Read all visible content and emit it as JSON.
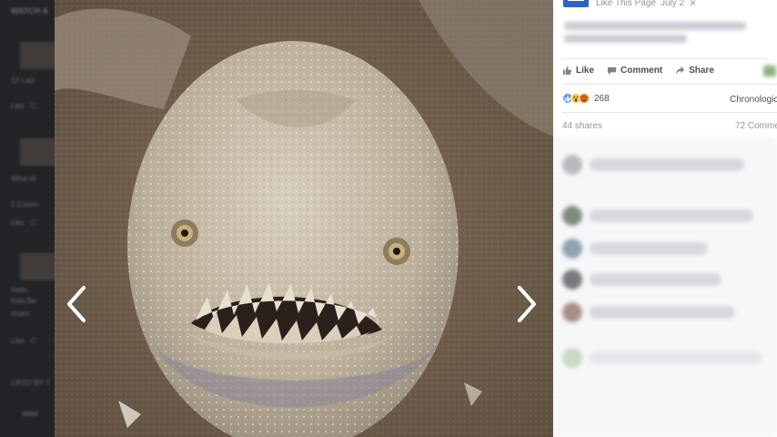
{
  "background_feed": {
    "header": "WATCH A",
    "labels": [
      "12 Last",
      "Like · C",
      "What di",
      "2 Comm",
      "Like · C",
      "Hello",
      "Kids Ba",
      "share",
      "Like · C",
      "LIKED BY T"
    ]
  },
  "viewer": {
    "prev_label": "Previous photo",
    "next_label": "Next photo"
  },
  "post": {
    "like_page": "Like This Page",
    "date": "July 2",
    "close_glyph": "×"
  },
  "actions": {
    "like": "Like",
    "comment": "Comment",
    "share": "Share"
  },
  "reactions": {
    "count": "268",
    "sort": "Chronologic"
  },
  "stats": {
    "shares": "44 shares",
    "comments": "72 Comme"
  },
  "colors": {
    "accent": "#2a62c7",
    "reaction_like": "#5890ff",
    "reaction_wow": "#f7c843",
    "reaction_angry": "#e9710f"
  }
}
